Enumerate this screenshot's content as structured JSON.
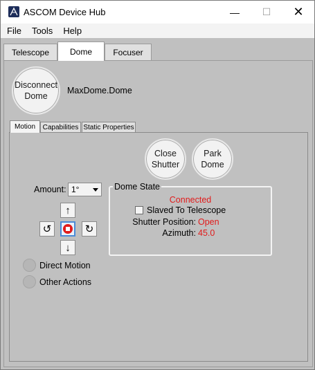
{
  "window": {
    "title": "ASCOM Device Hub",
    "minimize_glyph": "—",
    "maximize_glyph": "☐",
    "close_glyph": "✕"
  },
  "menu": {
    "items": [
      "File",
      "Tools",
      "Help"
    ]
  },
  "main_tabs": [
    {
      "label": "Telescope",
      "selected": false
    },
    {
      "label": "Dome",
      "selected": true
    },
    {
      "label": "Focuser",
      "selected": false
    }
  ],
  "connection": {
    "button_line1": "Disconnect",
    "button_line2": "Dome",
    "device_name": "MaxDome.Dome"
  },
  "sub_tabs": [
    {
      "label": "Motion",
      "selected": true
    },
    {
      "label": "Capabilities",
      "selected": false
    },
    {
      "label": "Static Properties",
      "selected": false
    }
  ],
  "actions": {
    "close_shutter_line1": "Close",
    "close_shutter_line2": "Shutter",
    "park_line1": "Park",
    "park_line2": "Dome"
  },
  "motion": {
    "amount_label": "Amount:",
    "amount_value": "1°",
    "up_glyph": "↑",
    "down_glyph": "↓",
    "ccw_glyph": "↺",
    "cw_glyph": "↻"
  },
  "radios": {
    "direct_motion": "Direct Motion",
    "other_actions": "Other Actions"
  },
  "dome_state": {
    "title": "Dome State",
    "status": "Connected",
    "slaved_label": "Slaved To Telescope",
    "slaved_checked": false,
    "shutter_label": "Shutter Position:",
    "shutter_value": "Open",
    "azimuth_label": "Azimuth:",
    "azimuth_value": "45.0"
  },
  "colors": {
    "background": "#c0c0c0",
    "status_red": "#e11b1b",
    "focus_blue": "#4a8ad6"
  }
}
